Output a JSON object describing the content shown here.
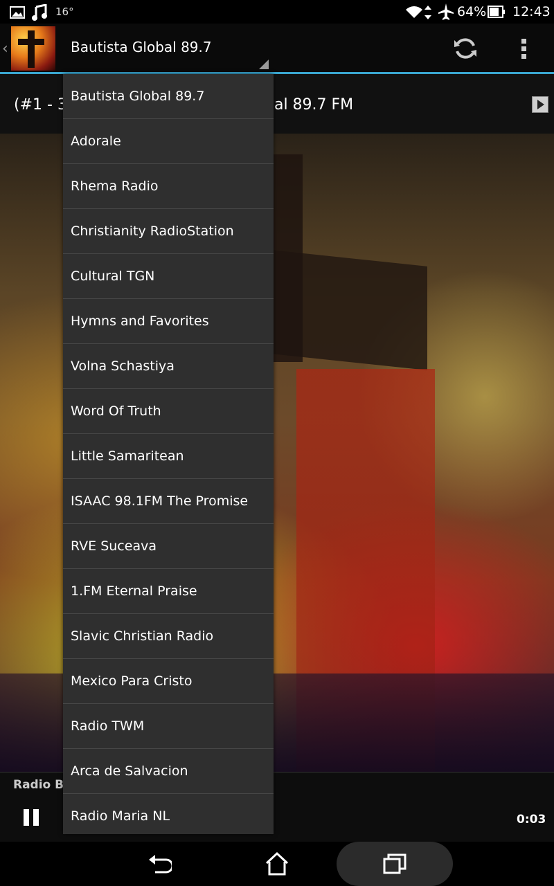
{
  "status_bar": {
    "temperature": "16°",
    "battery": "64%",
    "time": "12:43",
    "icons": [
      "picture-icon",
      "music-note-icon",
      "wifi-icon",
      "airplane-icon",
      "battery-icon"
    ]
  },
  "action_bar": {
    "back": "‹",
    "spinner_selected": "Bautista Global 89.7",
    "icons": [
      "app-logo",
      "refresh-icon",
      "overflow-menu-icon"
    ]
  },
  "now_playing": {
    "left_text": "(#1 - 31",
    "right_text": "bal 89.7 FM"
  },
  "player": {
    "station_label": "Radio Ba",
    "elapsed": "0:03"
  },
  "dropdown": {
    "items": [
      "Bautista Global 89.7",
      "Adorale",
      "Rhema Radio",
      "Christianity RadioStation",
      "Cultural TGN",
      "Hymns and Favorites",
      "Volna Schastiya",
      "Word Of Truth",
      "Little Samaritean",
      "ISAAC 98.1FM The Promise",
      "RVE Suceava",
      "1.FM Eternal Praise",
      "Slavic Christian Radio",
      "Mexico Para Cristo",
      "Radio TWM",
      "Arca de Salvacion",
      "Radio Maria NL"
    ]
  },
  "colors": {
    "accent": "#3aa6cf",
    "dropdown_bg": "#2f2f2f"
  }
}
